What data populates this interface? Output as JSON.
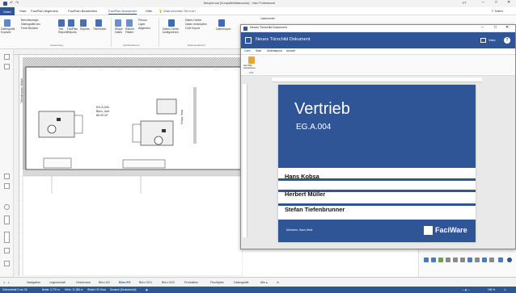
{
  "app": {
    "title": "Beispiel.vsd [Kompatibilitätsmodus] - Visio Professional",
    "account_initials": "FT",
    "share_label": "Teilen"
  },
  "ribbon_tabs": [
    "Datei",
    "Start",
    "FaciPlan Allgemein",
    "FaciPlan Bearbeiten",
    "FaciPlan Auswerten",
    "Hilfe",
    "Was möchten Sie tun?"
  ],
  "ribbon": {
    "buttons": [
      {
        "label": "Datengrafik\nExplorer"
      },
      {
        "label": "Berichtsshape"
      },
      {
        "label": "Datengrafik neu"
      },
      {
        "label": "Freie Berichte"
      },
      {
        "label": "Text\nReports"
      },
      {
        "label": "FaciPlan\nReports"
      },
      {
        "label": "Reports"
      },
      {
        "label": "Tischfolder"
      },
      {
        "label": "Shape\nDaten"
      },
      {
        "label": "Räume\nFläche"
      },
      {
        "label": "Person"
      },
      {
        "label": "Layer"
      },
      {
        "label": "Allgemein"
      },
      {
        "label": "Daten-Center\nkonfigurieren"
      },
      {
        "label": "Daten-Center"
      },
      {
        "label": "Daten verknüpfen"
      },
      {
        "label": "CAD Export"
      },
      {
        "label": "Datenexport"
      },
      {
        "label": "Lasercenter"
      }
    ],
    "groups": [
      "Auswertung",
      "Suchfunktionen",
      "Datenaustausch"
    ]
  },
  "drawing": {
    "room_label": "EG.A.004",
    "room_sub": "Büro, Juni",
    "room_area": "80.29 m²",
    "wall_label_left": "Tiefenbrunner, Stefan",
    "wall_label_right": "Kobsa, Hans"
  },
  "bottom_tabs": [
    "Navigation",
    "Legenschaft",
    "Geschosse",
    "Büro UG",
    "Büro EG",
    "Büro OG1",
    "Büro OG2",
    "Produktion",
    "Fluchtplan",
    "Datengrafik",
    "Alle ▴"
  ],
  "status": {
    "page": "Zeichenblatt 3 von 26",
    "width": "Breite: 0,770 m",
    "height": "Höhe: 11,386 m",
    "angle": "Winkel: 90 Grad",
    "language": "Deutsch (Deutschland)",
    "zoom": "196 %"
  },
  "popup": {
    "title": "Neues Türschild Dokument",
    "header": "Neues Türschild Dokument",
    "view_label": "Visio",
    "tabs": [
      "Datei",
      "Start",
      "Seitenlayout",
      "Ansicht"
    ],
    "export_label": "Als PDF\nexportieren",
    "export_group": "PDF"
  },
  "door_sign": {
    "department": "Vertrieb",
    "room": "EG.A.004",
    "persons": [
      "Hans Kobsa",
      "Herbert Müller",
      "Stefan Tiefenbrunner"
    ],
    "footer_left": "München, Haus West",
    "brand": "FaciWare"
  },
  "colors": {
    "accent": "#2f5597",
    "window_bg": "#ffffff",
    "statusbar": "#2f5597"
  }
}
